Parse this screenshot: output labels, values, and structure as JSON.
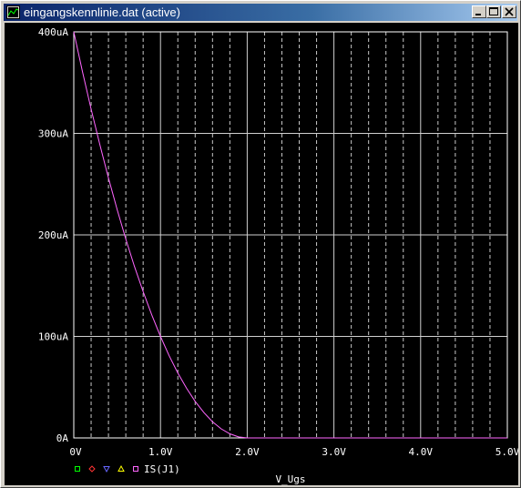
{
  "window": {
    "title": "eingangskennlinie.dat (active)",
    "icon": "probe-app-icon",
    "buttons": [
      "minimize-icon",
      "maximize-icon",
      "close-icon"
    ]
  },
  "colors": {
    "plot_background": "#000000",
    "axis": "#ffffff",
    "text": "#ffffff",
    "trace": "#ff66ff",
    "legend_square": "#00ff00",
    "legend_diamond": "#ff3333",
    "legend_down_triangle": "#6666ff",
    "legend_up_triangle": "#ffff00"
  },
  "legend": {
    "symbols": [
      "square",
      "diamond",
      "down-triangle",
      "up-triangle"
    ],
    "trace_label": "IS(J1)"
  },
  "chart_data": {
    "type": "line",
    "title": "",
    "xlabel": "V_Ugs",
    "ylabel": "",
    "xlim": [
      0,
      5
    ],
    "ylim": [
      0,
      400
    ],
    "x_ticks": [
      0,
      1,
      2,
      3,
      4,
      5
    ],
    "x_tick_labels": [
      "0V",
      "1.0V",
      "2.0V",
      "3.0V",
      "4.0V",
      "5.0V"
    ],
    "y_ticks": [
      0,
      100,
      200,
      300,
      400
    ],
    "y_tick_labels": [
      "0A",
      "100uA",
      "200uA",
      "300uA",
      "400uA"
    ],
    "grid": true,
    "minor_grid_x_dashed": [
      0.2,
      0.4,
      0.6,
      0.8,
      1.2,
      1.4,
      1.6,
      1.8,
      2.2,
      2.4,
      2.6,
      2.8,
      3.2,
      3.4,
      3.6,
      3.8,
      4.2,
      4.4,
      4.6,
      4.8
    ],
    "series": [
      {
        "name": "IS(J1)",
        "x": [
          0,
          0.1,
          0.2,
          0.3,
          0.4,
          0.5,
          0.6,
          0.7,
          0.8,
          0.9,
          1.0,
          1.1,
          1.2,
          1.3,
          1.4,
          1.5,
          1.6,
          1.7,
          1.8,
          1.9,
          2.0,
          2.5,
          3.0,
          3.5,
          4.0,
          4.5,
          5.0
        ],
        "y": [
          400,
          361,
          324,
          289,
          256,
          225,
          196,
          169,
          144,
          121,
          100,
          81,
          64,
          49,
          36,
          25,
          16,
          9,
          4,
          1,
          0,
          0,
          0,
          0,
          0,
          0,
          0
        ]
      }
    ]
  }
}
